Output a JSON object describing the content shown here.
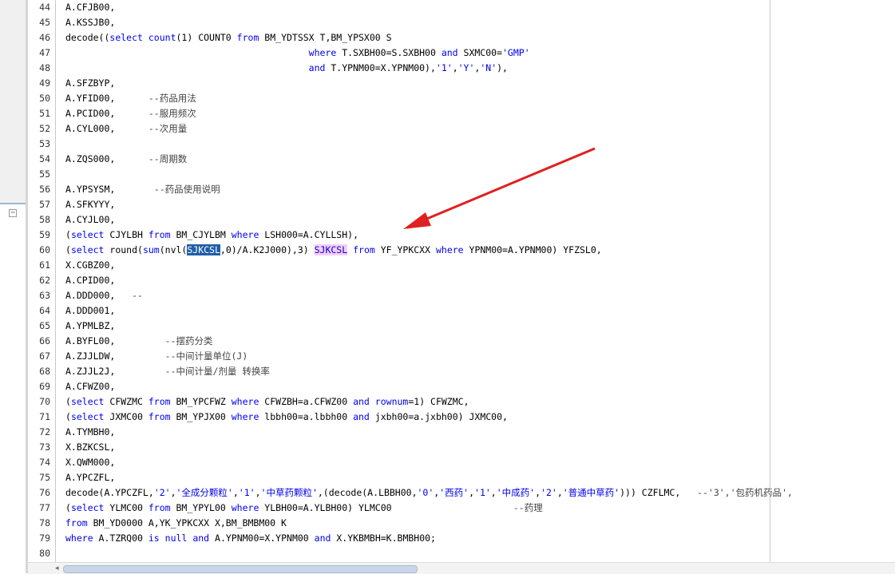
{
  "editor": {
    "collapse_glyph": "−",
    "scroll_left_glyph": "◂",
    "lines": [
      {
        "n": "44",
        "html": "A.CFJB00,"
      },
      {
        "n": "45",
        "html": "A.KSSJB0,"
      },
      {
        "n": "46",
        "html": "decode((<span class=\"kw\">select</span> <span class=\"kw\">count</span>(1) COUNT0 <span class=\"kw\">from</span> BM_YDTSSX T,BM_YPSX00 S"
      },
      {
        "n": "47",
        "html": "                                            <span class=\"kw\">where</span> T.SXBH00=S.SXBH00 <span class=\"kw\">and</span> SXMC00=<span class=\"str\">'GMP'</span>"
      },
      {
        "n": "48",
        "html": "                                            <span class=\"kw\">and</span> T.YPNM00=X.YPNM00),<span class=\"str\">'1'</span>,<span class=\"str\">'Y'</span>,<span class=\"str\">'N'</span>),"
      },
      {
        "n": "49",
        "html": "A.SFZBYP,"
      },
      {
        "n": "50",
        "html": "A.YFID00,      <span class=\"cm\">--药品用法</span>"
      },
      {
        "n": "51",
        "html": "A.PCID00,      <span class=\"cm\">--服用频次</span>"
      },
      {
        "n": "52",
        "html": "A.CYL000,      <span class=\"cm\">--次用量</span>"
      },
      {
        "n": "53",
        "html": ""
      },
      {
        "n": "54",
        "html": "A.ZQS000,      <span class=\"cm\">--周期数</span>"
      },
      {
        "n": "55",
        "html": ""
      },
      {
        "n": "56",
        "html": "A.YPSYSM,       <span class=\"cm\">--药品使用说明</span>"
      },
      {
        "n": "57",
        "html": "A.SFKYYY,"
      },
      {
        "n": "58",
        "html": "A.CYJL00,"
      },
      {
        "n": "59",
        "html": "(<span class=\"kw\">select</span> CJYLBH <span class=\"kw\">from</span> BM_CJYLBM <span class=\"kw\">where</span> LSH000=A.CYLLSH),"
      },
      {
        "n": "60",
        "html": "(<span class=\"kw\">select</span> round(<span class=\"kw\">sum</span>(nvl(<span class=\"sel\">SJKCSL</span>,0)/A.K2J000),3) <span class=\"hl\">SJKCSL</span> <span class=\"kw\">from</span> YF_YPKCXX <span class=\"kw\">where</span> YPNM00=A.YPNM00) YFZSL0,"
      },
      {
        "n": "61",
        "html": "X.CGBZ00,"
      },
      {
        "n": "62",
        "html": "A.CPID00,"
      },
      {
        "n": "63",
        "html": "A.DDD000,   <span class=\"cm\">--</span>"
      },
      {
        "n": "64",
        "html": "A.DDD001,"
      },
      {
        "n": "65",
        "html": "A.YPMLBZ,"
      },
      {
        "n": "66",
        "html": "A.BYFL00,         <span class=\"cm\">--摆药分类</span>"
      },
      {
        "n": "67",
        "html": "A.ZJJLDW,         <span class=\"cm\">--中间计量单位(J)</span>"
      },
      {
        "n": "68",
        "html": "A.ZJJL2J,         <span class=\"cm\">--中间计量/剂量 转换率</span>"
      },
      {
        "n": "69",
        "html": "A.CFWZ00,"
      },
      {
        "n": "70",
        "html": "(<span class=\"kw\">select</span> CFWZMC <span class=\"kw\">from</span> BM_YPCFWZ <span class=\"kw\">where</span> CFWZBH=a.CFWZ00 <span class=\"kw\">and</span> <span class=\"kw\">rownum</span>=1) CFWZMC,"
      },
      {
        "n": "71",
        "html": "(<span class=\"kw\">select</span> JXMC00 <span class=\"kw\">from</span> BM_YPJX00 <span class=\"kw\">where</span> lbbh00=a.lbbh00 <span class=\"kw\">and</span> jxbh00=a.jxbh00) JXMC00,"
      },
      {
        "n": "72",
        "html": "A.TYMBH0,"
      },
      {
        "n": "73",
        "html": "X.BZKCSL,"
      },
      {
        "n": "74",
        "html": "X.QWM000,"
      },
      {
        "n": "75",
        "html": "A.YPCZFL,"
      },
      {
        "n": "76",
        "html": "decode(A.YPCZFL,<span class=\"str\">'2'</span>,<span class=\"str\">'全成分颗粒'</span>,<span class=\"str\">'1'</span>,<span class=\"str\">'中草药颗粒'</span>,(decode(A.LBBH00,<span class=\"str\">'0'</span>,<span class=\"str\">'西药'</span>,<span class=\"str\">'1'</span>,<span class=\"str\">'中成药'</span>,<span class=\"str\">'2'</span>,<span class=\"str\">'普通中草药'</span>))) CZFLMC,   <span class=\"cm\">--'3','包药机药品',</span>"
      },
      {
        "n": "77",
        "html": "(<span class=\"kw\">select</span> YLMC00 <span class=\"kw\">from</span> BM_YPYL00 <span class=\"kw\">where</span> YLBH00=A.YLBH00) YLMC00                      <span class=\"cm\">--药理</span>"
      },
      {
        "n": "78",
        "html": "<span class=\"kw\">from</span> BM_YD0000 A,YK_YPKCXX X,BM_BMBM00 K"
      },
      {
        "n": "79",
        "html": "<span class=\"kw\">where</span> A.TZRQ00 <span class=\"kw\">is</span> <span class=\"kw\">null</span> <span class=\"kw\">and</span> A.YPNM00=X.YPNM00 <span class=\"kw\">and</span> X.YKBMBH=K.BMBH00;"
      },
      {
        "n": "80",
        "html": ""
      }
    ]
  },
  "colors": {
    "keyword": "#0000ee",
    "selection": "#1f5ea8",
    "highlight": "#f7cdf0",
    "annotation_arrow": "#e02020"
  }
}
